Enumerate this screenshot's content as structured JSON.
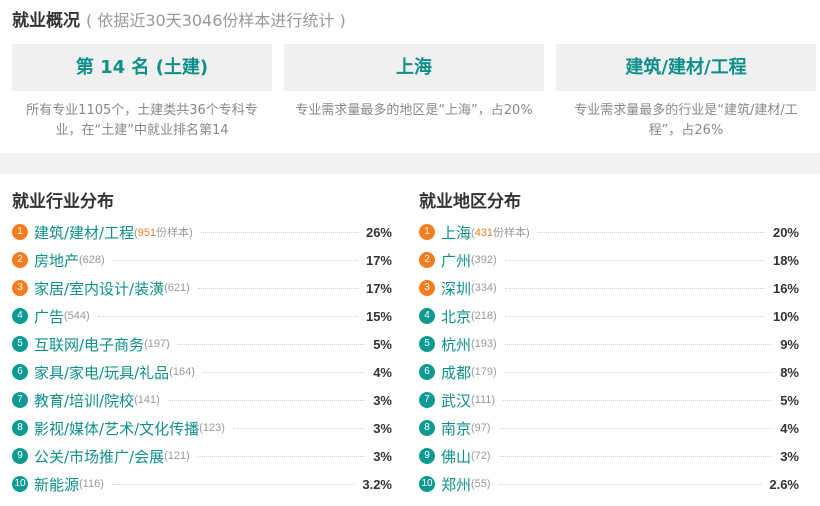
{
  "overview": {
    "title": "就业概况",
    "subtitle": "( 依据近30天3046份样本进行统计 )",
    "cards": [
      {
        "headline": "第 14 名 (土建)",
        "desc": "所有专业1105个，土建类共36个专科专业，在“土建”中就业排名第14"
      },
      {
        "headline": "上海",
        "desc": "专业需求量最多的地区是“上海”，占20%"
      },
      {
        "headline": "建筑/建材/工程",
        "desc": "专业需求量最多的行业是“建筑/建材/工程”，占26%"
      }
    ]
  },
  "industry": {
    "title": "就业行业分布",
    "rows": [
      {
        "rank": "1",
        "name": "建筑/建材/工程",
        "count": "951",
        "sample_label": "份样本",
        "percent": "26%"
      },
      {
        "rank": "2",
        "name": "房地产",
        "count": "(628)",
        "percent": "17%"
      },
      {
        "rank": "3",
        "name": "家居/室内设计/装潢",
        "count": "(621)",
        "percent": "17%"
      },
      {
        "rank": "4",
        "name": "广告",
        "count": "(544)",
        "percent": "15%"
      },
      {
        "rank": "5",
        "name": "互联网/电子商务",
        "count": "(197)",
        "percent": "5%"
      },
      {
        "rank": "6",
        "name": "家具/家电/玩具/礼品",
        "count": "(164)",
        "percent": "4%"
      },
      {
        "rank": "7",
        "name": "教育/培训/院校",
        "count": "(141)",
        "percent": "3%"
      },
      {
        "rank": "8",
        "name": "影视/媒体/艺术/文化传播",
        "count": "(123)",
        "percent": "3%"
      },
      {
        "rank": "9",
        "name": "公关/市场推广/会展",
        "count": "(121)",
        "percent": "3%"
      },
      {
        "rank": "10",
        "name": "新能源",
        "count": "(116)",
        "percent": "3.2%"
      }
    ]
  },
  "region": {
    "title": "就业地区分布",
    "rows": [
      {
        "rank": "1",
        "name": "上海",
        "count": "431",
        "sample_label": "份样本",
        "percent": "20%"
      },
      {
        "rank": "2",
        "name": "广州",
        "count": "(392)",
        "percent": "18%"
      },
      {
        "rank": "3",
        "name": "深圳",
        "count": "(334)",
        "percent": "16%"
      },
      {
        "rank": "4",
        "name": "北京",
        "count": "(218)",
        "percent": "10%"
      },
      {
        "rank": "5",
        "name": "杭州",
        "count": "(193)",
        "percent": "9%"
      },
      {
        "rank": "6",
        "name": "成都",
        "count": "(179)",
        "percent": "8%"
      },
      {
        "rank": "7",
        "name": "武汉",
        "count": "(111)",
        "percent": "5%"
      },
      {
        "rank": "8",
        "name": "南京",
        "count": "(97)",
        "percent": "4%"
      },
      {
        "rank": "9",
        "name": "佛山",
        "count": "(72)",
        "percent": "3%"
      },
      {
        "rank": "10",
        "name": "郑州",
        "count": "(55)",
        "percent": "2.6%"
      }
    ]
  },
  "colors": {
    "accent": "#0e8f8a",
    "rank_top": "#f57c1f",
    "rank_other": "#0e9a93"
  }
}
